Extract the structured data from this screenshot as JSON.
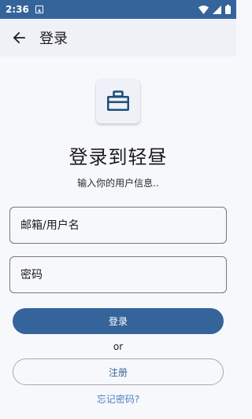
{
  "status_bar": {
    "time": "2:36",
    "icons": [
      "notification-icon",
      "wifi-icon",
      "signal-icon",
      "battery-icon"
    ]
  },
  "app_bar": {
    "title": "登录",
    "back_icon": "arrow-left-icon"
  },
  "logo": {
    "icon": "briefcase-icon"
  },
  "heading": "登录到轻昼",
  "subheading": "输入你的用户信息..",
  "form": {
    "email_placeholder": "邮箱/用户名",
    "email_value": "",
    "password_placeholder": "密码",
    "password_value": ""
  },
  "buttons": {
    "login": "登录",
    "or": "or",
    "register": "注册",
    "forgot_password": "忘记密码?"
  },
  "colors": {
    "primary": "#35649a",
    "status_bar": "#35649a",
    "link": "#4a7fc0",
    "background": "#f7f8fc"
  }
}
